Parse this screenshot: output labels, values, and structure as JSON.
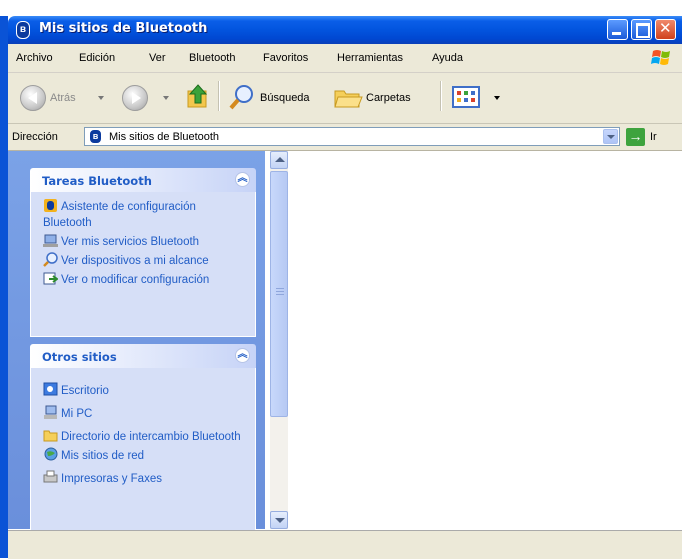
{
  "window": {
    "title": "Mis sitios de Bluetooth"
  },
  "menu": [
    "Archivo",
    "Edición",
    "Ver",
    "Bluetooth",
    "Favoritos",
    "Herramientas",
    "Ayuda"
  ],
  "toolbar": {
    "back_label": "Atrás",
    "search_label": "Búsqueda",
    "folders_label": "Carpetas"
  },
  "address": {
    "label": "Dirección",
    "value": "Mis sitios de Bluetooth",
    "go_label": "Ir"
  },
  "tasks_panel": {
    "title": "Tareas Bluetooth",
    "items": [
      {
        "label": "Asistente de configuración Bluetooth",
        "icon": "bluetooth-wizard-icon"
      },
      {
        "label": "Ver mis servicios Bluetooth",
        "icon": "computer-services-icon"
      },
      {
        "label": "Ver dispositivos a mi alcance",
        "icon": "search-icon"
      },
      {
        "label": "Ver o modificar configuración",
        "icon": "config-icon"
      }
    ]
  },
  "other_places": {
    "title": "Otros sitios",
    "items": [
      {
        "label": "Escritorio",
        "icon": "desktop-icon"
      },
      {
        "label": "Mi PC",
        "icon": "my-computer-icon"
      },
      {
        "label": "Directorio de intercambio Bluetooth",
        "icon": "folder-icon"
      },
      {
        "label": "Mis sitios de red",
        "icon": "network-places-icon"
      },
      {
        "label": "Impresoras y Faxes",
        "icon": "printers-icon"
      }
    ]
  },
  "colors": {
    "title_bar": "#0254de",
    "task_link": "#215dc6",
    "pane_bg": "#7ba2e7",
    "chrome_bg": "#ece9d8"
  }
}
